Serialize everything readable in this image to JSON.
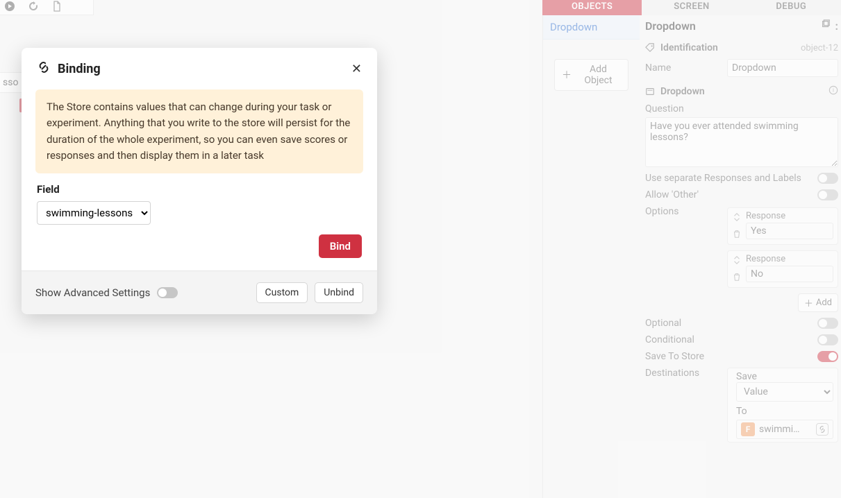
{
  "top_tabs": {
    "objects": "OBJECTS",
    "screen": "SCREEN",
    "debug": "DEBUG"
  },
  "object_list": {
    "item": "Dropdown",
    "add": "Add Object"
  },
  "props": {
    "title": "Dropdown",
    "identification": {
      "heading": "Identification",
      "id": "object-12",
      "name_label": "Name",
      "name_value": "Dropdown"
    },
    "dropdown": {
      "heading": "Dropdown",
      "question_label": "Question",
      "question_value": "Have you ever attended swimming lessons?",
      "separate_label": "Use separate Responses and Labels",
      "allow_other_label": "Allow 'Other'",
      "options_label": "Options",
      "response_label": "Response",
      "responses": [
        "Yes",
        "No"
      ],
      "add": "Add",
      "optional_label": "Optional",
      "conditional_label": "Conditional",
      "save_label": "Save To Store",
      "destinations_label": "Destinations",
      "save_word": "Save",
      "save_value": "Value",
      "to_word": "To",
      "to_badge": "F",
      "to_value": "swimmi…"
    }
  },
  "left_snippet": "sso",
  "modal": {
    "title": "Binding",
    "info": "The Store contains values that can change during your task or experiment. Anything that you write to the store will persist for the duration of the whole experiment, so you can even save scores or responses and then display them in a later task",
    "field_label": "Field",
    "field_value": "swimming-lessons",
    "bind": "Bind",
    "adv": "Show Advanced Settings",
    "custom": "Custom",
    "unbind": "Unbind"
  }
}
